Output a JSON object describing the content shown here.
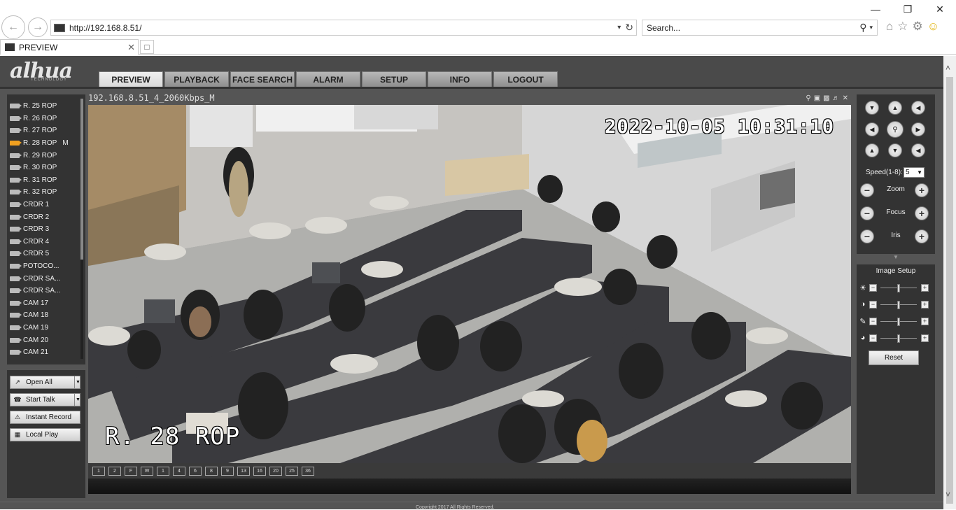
{
  "browser": {
    "url": "http://192.168.8.51/",
    "search_placeholder": "Search...",
    "tab_title": "PREVIEW"
  },
  "app": {
    "logo": "álhua",
    "logo_sub": "TECHNOLOGY",
    "nav_tabs": [
      "PREVIEW",
      "PLAYBACK",
      "FACE SEARCH",
      "ALARM",
      "SETUP",
      "INFO",
      "LOGOUT"
    ],
    "active_tab": "PREVIEW"
  },
  "cameras": [
    {
      "label": "R. 25 ROP",
      "flag": ""
    },
    {
      "label": "R. 26 ROP",
      "flag": ""
    },
    {
      "label": "R. 27 ROP",
      "flag": ""
    },
    {
      "label": "R. 28 ROP",
      "flag": "M"
    },
    {
      "label": "R. 29 ROP",
      "flag": ""
    },
    {
      "label": "R. 30 ROP",
      "flag": ""
    },
    {
      "label": "R. 31 ROP",
      "flag": ""
    },
    {
      "label": "R. 32 ROP",
      "flag": ""
    },
    {
      "label": "CRDR 1",
      "flag": ""
    },
    {
      "label": "CRDR 2",
      "flag": ""
    },
    {
      "label": "CRDR 3",
      "flag": ""
    },
    {
      "label": "CRDR 4",
      "flag": ""
    },
    {
      "label": "CRDR 5",
      "flag": ""
    },
    {
      "label": "POTOCO...",
      "flag": ""
    },
    {
      "label": "CRDR SA...",
      "flag": ""
    },
    {
      "label": "CRDR SA...",
      "flag": ""
    },
    {
      "label": "CAM 17",
      "flag": ""
    },
    {
      "label": "CAM 18",
      "flag": ""
    },
    {
      "label": "CAM 19",
      "flag": ""
    },
    {
      "label": "CAM 20",
      "flag": ""
    },
    {
      "label": "CAM 21",
      "flag": ""
    }
  ],
  "active_camera_index": 3,
  "controls": {
    "open_all": "Open All",
    "start_talk": "Start Talk",
    "instant_record": "Instant Record",
    "local_play": "Local Play"
  },
  "video": {
    "stream_title": "192.168.8.51_4_2060Kbps_M",
    "timestamp": "2022-10-05 10:31:10",
    "channel_name": "R. 28 ROP"
  },
  "layouts": [
    "1",
    "2",
    "F",
    "W",
    "1",
    "4",
    "6",
    "8",
    "9",
    "13",
    "16",
    "20",
    "25",
    "36"
  ],
  "ptz": {
    "speed_label": "Speed(1-8):",
    "speed_value": "5",
    "zoom_label": "Zoom",
    "focus_label": "Focus",
    "iris_label": "Iris"
  },
  "image_setup": {
    "title": "Image Setup",
    "reset_label": "Reset",
    "sliders": [
      {
        "icon": "brightness-icon",
        "value": 0.5
      },
      {
        "icon": "contrast-icon",
        "value": 0.5
      },
      {
        "icon": "saturation-icon",
        "value": 0.5
      },
      {
        "icon": "hue-icon",
        "value": 0.5
      }
    ]
  },
  "footer": {
    "copyright": "Copyright 2017 All Rights Reserved."
  }
}
